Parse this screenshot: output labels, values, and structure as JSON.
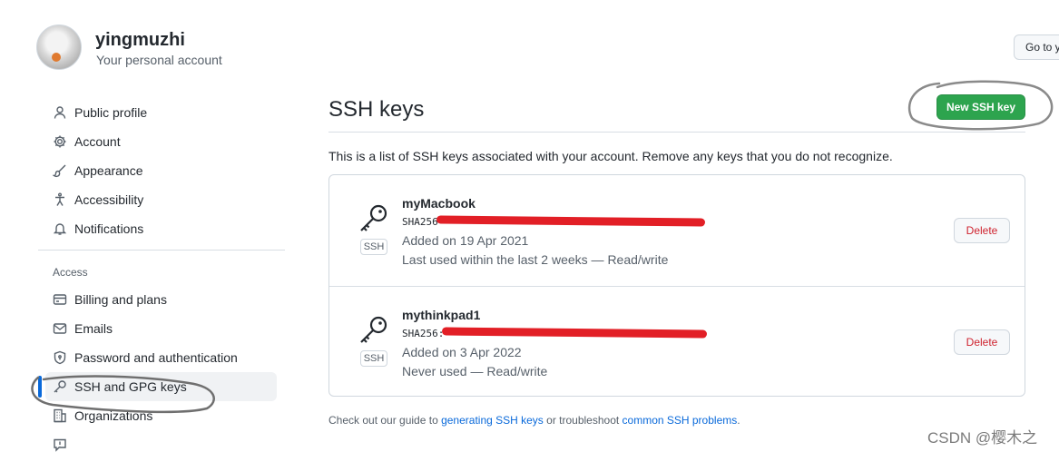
{
  "account": {
    "username": "yingmuzhi",
    "subtitle": "Your personal account",
    "goto_label": "Go to y"
  },
  "sidebar": {
    "items": [
      {
        "label": "Public profile",
        "icon": "person-icon"
      },
      {
        "label": "Account",
        "icon": "gear-icon"
      },
      {
        "label": "Appearance",
        "icon": "paintbrush-icon"
      },
      {
        "label": "Accessibility",
        "icon": "accessibility-icon"
      },
      {
        "label": "Notifications",
        "icon": "bell-icon"
      }
    ],
    "access_label": "Access",
    "access_items": [
      {
        "label": "Billing and plans",
        "icon": "credit-card-icon"
      },
      {
        "label": "Emails",
        "icon": "mail-icon"
      },
      {
        "label": "Password and authentication",
        "icon": "shield-lock-icon"
      },
      {
        "label": "SSH and GPG keys",
        "icon": "key-icon",
        "active": true
      },
      {
        "label": "Organizations",
        "icon": "organization-icon"
      }
    ]
  },
  "main": {
    "title": "SSH keys",
    "new_key_label": "New SSH key",
    "intro": "This is a list of SSH keys associated with your account. Remove any keys that you do not recognize.",
    "keys": [
      {
        "name": "myMacbook",
        "fingerprint_prefix": "SHA256",
        "added": "Added on 19 Apr 2021",
        "last_used": "Last used within the last 2 weeks — Read/write",
        "badge": "SSH",
        "delete_label": "Delete"
      },
      {
        "name": "mythinkpad1",
        "fingerprint_prefix": "SHA256:",
        "added": "Added on 3 Apr 2022",
        "last_used": "Never used — Read/write",
        "badge": "SSH",
        "delete_label": "Delete"
      }
    ],
    "footer": {
      "prefix": "Check out our guide to ",
      "link1": "generating SSH keys",
      "middle": " or troubleshoot ",
      "link2": "common SSH problems",
      "suffix": "."
    }
  },
  "watermark": "CSDN @樱木之",
  "colors": {
    "primary_button": "#2da44e",
    "danger": "#cf222e",
    "link": "#0969da",
    "active_marker": "#0969da",
    "redaction": "#e21f26"
  }
}
